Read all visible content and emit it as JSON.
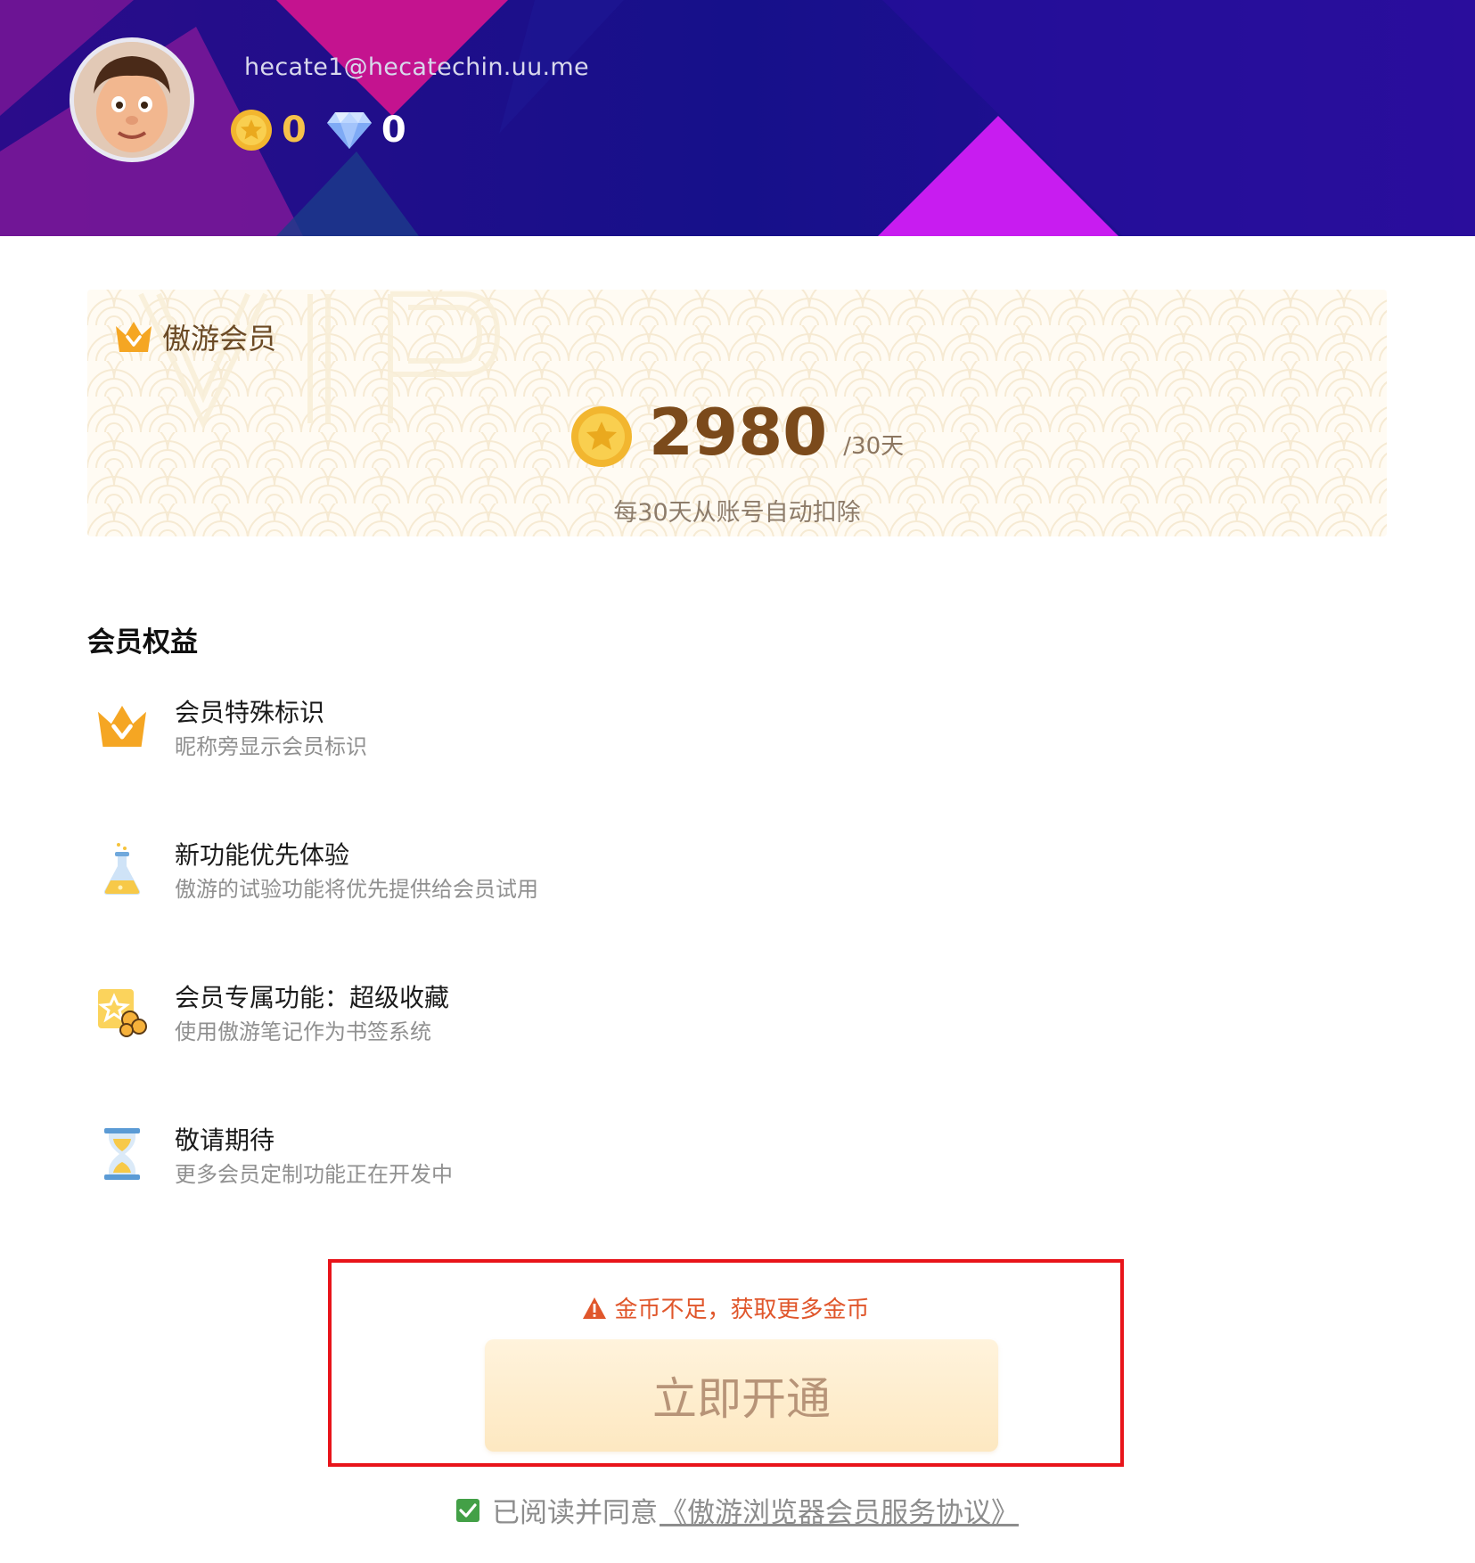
{
  "header": {
    "email": "hecate1@hecatechin.uu.me",
    "coin_balance": "0",
    "diamond_balance": "0"
  },
  "vip": {
    "title": "傲游会员",
    "price": "2980",
    "unit": "/30天",
    "note": "每30天从账号自动扣除"
  },
  "benefits": {
    "title": "会员权益",
    "items": [
      {
        "title": "会员特殊标识",
        "desc": "昵称旁显示会员标识",
        "icon": "crown-icon"
      },
      {
        "title": "新功能优先体验",
        "desc": "傲游的试验功能将优先提供给会员试用",
        "icon": "flask-icon"
      },
      {
        "title": "会员专属功能：超级收藏",
        "desc": "使用傲游笔记作为书签系统",
        "icon": "super-favorite-icon"
      },
      {
        "title": "敬请期待",
        "desc": "更多会员定制功能正在开发中",
        "icon": "hourglass-icon"
      }
    ]
  },
  "action": {
    "warning": "金币不足，获取更多金币",
    "button_label": "立即开通"
  },
  "agreement": {
    "prefix": "已阅读并同意",
    "link": "《傲游浏览器会员服务协议》",
    "checked": true
  },
  "colors": {
    "header_bg": "#1a0d86",
    "accent_magenta": "#c81cf0",
    "coin_gold": "#f6c24a",
    "price_brown": "#7b4a1b",
    "warning": "#e0562b",
    "highlight_border": "#e8141a",
    "check_green": "#43a047"
  }
}
